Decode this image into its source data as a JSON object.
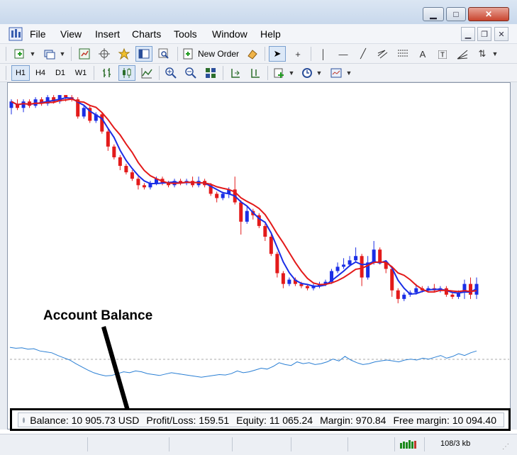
{
  "menu": {
    "items": [
      "File",
      "View",
      "Insert",
      "Charts",
      "Tools",
      "Window",
      "Help"
    ]
  },
  "toolbar": {
    "new_order_label": "New Order",
    "timeframes": [
      "H1",
      "H4",
      "D1",
      "W1"
    ]
  },
  "annotation": {
    "text": "Account Balance"
  },
  "terminal": {
    "balance": "Balance: 10 905.73 USD",
    "profit_loss": "Profit/Loss: 159.51",
    "equity": "Equity: 11 065.24",
    "margin": "Margin: 970.84",
    "free_margin": "Free margin: 10 094.40"
  },
  "statusbar": {
    "traffic": "108/3 kb"
  },
  "colors": {
    "bull_candle": "#1a2ee6",
    "bear_candle": "#e31a1a",
    "ma_fast": "#1a2ee6",
    "ma_slow": "#e31a1a",
    "indicator_line": "#2a7fd4"
  },
  "chart_data": {
    "type": "candlestick",
    "candles": [
      [
        0.6,
        0.63,
        0.57,
        0.64
      ],
      [
        0.62,
        0.6,
        0.59,
        0.64
      ],
      [
        0.6,
        0.63,
        0.58,
        0.64
      ],
      [
        0.63,
        0.61,
        0.6,
        0.64
      ],
      [
        0.61,
        0.64,
        0.6,
        0.65
      ],
      [
        0.64,
        0.62,
        0.61,
        0.65
      ],
      [
        0.62,
        0.65,
        0.61,
        0.66
      ],
      [
        0.65,
        0.63,
        0.62,
        0.66
      ],
      [
        0.63,
        0.66,
        0.62,
        0.66
      ],
      [
        0.66,
        0.65,
        0.63,
        0.66
      ],
      [
        0.65,
        0.64,
        0.63,
        0.66
      ],
      [
        0.64,
        0.56,
        0.55,
        0.65
      ],
      [
        0.56,
        0.6,
        0.55,
        0.61
      ],
      [
        0.6,
        0.54,
        0.53,
        0.61
      ],
      [
        0.54,
        0.57,
        0.53,
        0.58
      ],
      [
        0.57,
        0.49,
        0.48,
        0.58
      ],
      [
        0.49,
        0.42,
        0.4,
        0.5
      ],
      [
        0.42,
        0.37,
        0.36,
        0.43
      ],
      [
        0.37,
        0.33,
        0.31,
        0.38
      ],
      [
        0.33,
        0.3,
        0.29,
        0.34
      ],
      [
        0.3,
        0.27,
        0.26,
        0.31
      ],
      [
        0.27,
        0.24,
        0.22,
        0.28
      ],
      [
        0.24,
        0.23,
        0.22,
        0.25
      ],
      [
        0.23,
        0.25,
        0.22,
        0.26
      ],
      [
        0.25,
        0.27,
        0.24,
        0.28
      ],
      [
        0.27,
        0.25,
        0.24,
        0.28
      ],
      [
        0.25,
        0.24,
        0.23,
        0.26
      ],
      [
        0.24,
        0.26,
        0.23,
        0.27
      ],
      [
        0.26,
        0.25,
        0.24,
        0.27
      ],
      [
        0.25,
        0.26,
        0.24,
        0.27
      ],
      [
        0.26,
        0.24,
        0.23,
        0.28
      ],
      [
        0.24,
        0.26,
        0.23,
        0.28
      ],
      [
        0.26,
        0.24,
        0.23,
        0.27
      ],
      [
        0.24,
        0.2,
        0.19,
        0.25
      ],
      [
        0.2,
        0.18,
        0.16,
        0.21
      ],
      [
        0.18,
        0.2,
        0.17,
        0.21
      ],
      [
        0.2,
        0.22,
        0.18,
        0.23
      ],
      [
        0.22,
        0.16,
        0.15,
        0.28
      ],
      [
        0.16,
        0.07,
        0.01,
        0.17
      ],
      [
        0.07,
        0.12,
        0.06,
        0.14
      ],
      [
        0.12,
        0.1,
        0.08,
        0.13
      ],
      [
        0.1,
        0.05,
        0.04,
        0.11
      ],
      [
        0.05,
        0.0,
        -0.02,
        0.06
      ],
      [
        0.0,
        -0.08,
        -0.09,
        0.01
      ],
      [
        -0.08,
        -0.17,
        -0.19,
        -0.07
      ],
      [
        -0.17,
        -0.22,
        -0.24,
        -0.16
      ],
      [
        -0.22,
        -0.2,
        -0.23,
        -0.19
      ],
      [
        -0.2,
        -0.22,
        -0.23,
        -0.19
      ],
      [
        -0.22,
        -0.23,
        -0.24,
        -0.21
      ],
      [
        -0.23,
        -0.24,
        -0.25,
        -0.22
      ],
      [
        -0.24,
        -0.23,
        -0.25,
        -0.22
      ],
      [
        -0.23,
        -0.22,
        -0.24,
        -0.21
      ],
      [
        -0.22,
        -0.21,
        -0.23,
        -0.2
      ],
      [
        -0.21,
        -0.16,
        -0.22,
        -0.15
      ],
      [
        -0.16,
        -0.14,
        -0.17,
        -0.12
      ],
      [
        -0.14,
        -0.13,
        -0.15,
        -0.1
      ],
      [
        -0.13,
        -0.11,
        -0.14,
        -0.09
      ],
      [
        -0.11,
        -0.09,
        -0.12,
        -0.05
      ],
      [
        -0.09,
        -0.19,
        -0.23,
        -0.08
      ],
      [
        -0.19,
        -0.12,
        -0.2,
        -0.09
      ],
      [
        -0.12,
        -0.06,
        -0.13,
        -0.02
      ],
      [
        -0.06,
        -0.12,
        -0.13,
        -0.05
      ],
      [
        -0.12,
        -0.15,
        -0.17,
        -0.11
      ],
      [
        -0.15,
        -0.25,
        -0.28,
        -0.14
      ],
      [
        -0.25,
        -0.29,
        -0.31,
        -0.24
      ],
      [
        -0.29,
        -0.27,
        -0.3,
        -0.26
      ],
      [
        -0.27,
        -0.26,
        -0.28,
        -0.25
      ],
      [
        -0.26,
        -0.24,
        -0.27,
        -0.22
      ],
      [
        -0.24,
        -0.25,
        -0.26,
        -0.23
      ],
      [
        -0.25,
        -0.24,
        -0.26,
        -0.23
      ],
      [
        -0.24,
        -0.25,
        -0.26,
        -0.22
      ],
      [
        -0.25,
        -0.24,
        -0.26,
        -0.23
      ],
      [
        -0.24,
        -0.27,
        -0.28,
        -0.23
      ],
      [
        -0.27,
        -0.28,
        -0.29,
        -0.26
      ],
      [
        -0.28,
        -0.26,
        -0.29,
        -0.25
      ],
      [
        -0.26,
        -0.22,
        -0.29,
        -0.2
      ],
      [
        -0.22,
        -0.27,
        -0.29,
        -0.19
      ],
      [
        -0.27,
        -0.22,
        -0.29,
        -0.19
      ]
    ],
    "indicator": [
      0.78,
      0.76,
      0.77,
      0.74,
      0.75,
      0.7,
      0.68,
      0.66,
      0.6,
      0.55,
      0.5,
      0.42,
      0.35,
      0.28,
      0.22,
      0.18,
      0.15,
      0.16,
      0.2,
      0.24,
      0.22,
      0.26,
      0.24,
      0.2,
      0.18,
      0.16,
      0.19,
      0.22,
      0.2,
      0.18,
      0.16,
      0.14,
      0.12,
      0.14,
      0.16,
      0.18,
      0.17,
      0.2,
      0.26,
      0.22,
      0.24,
      0.28,
      0.32,
      0.3,
      0.36,
      0.44,
      0.4,
      0.38,
      0.46,
      0.42,
      0.44,
      0.4,
      0.42,
      0.46,
      0.52,
      0.48,
      0.58,
      0.5,
      0.44,
      0.4,
      0.42,
      0.46,
      0.48,
      0.5,
      0.48,
      0.46,
      0.5,
      0.52,
      0.5,
      0.54,
      0.52,
      0.56,
      0.6,
      0.54,
      0.58,
      0.64,
      0.6,
      0.66,
      0.7
    ]
  }
}
